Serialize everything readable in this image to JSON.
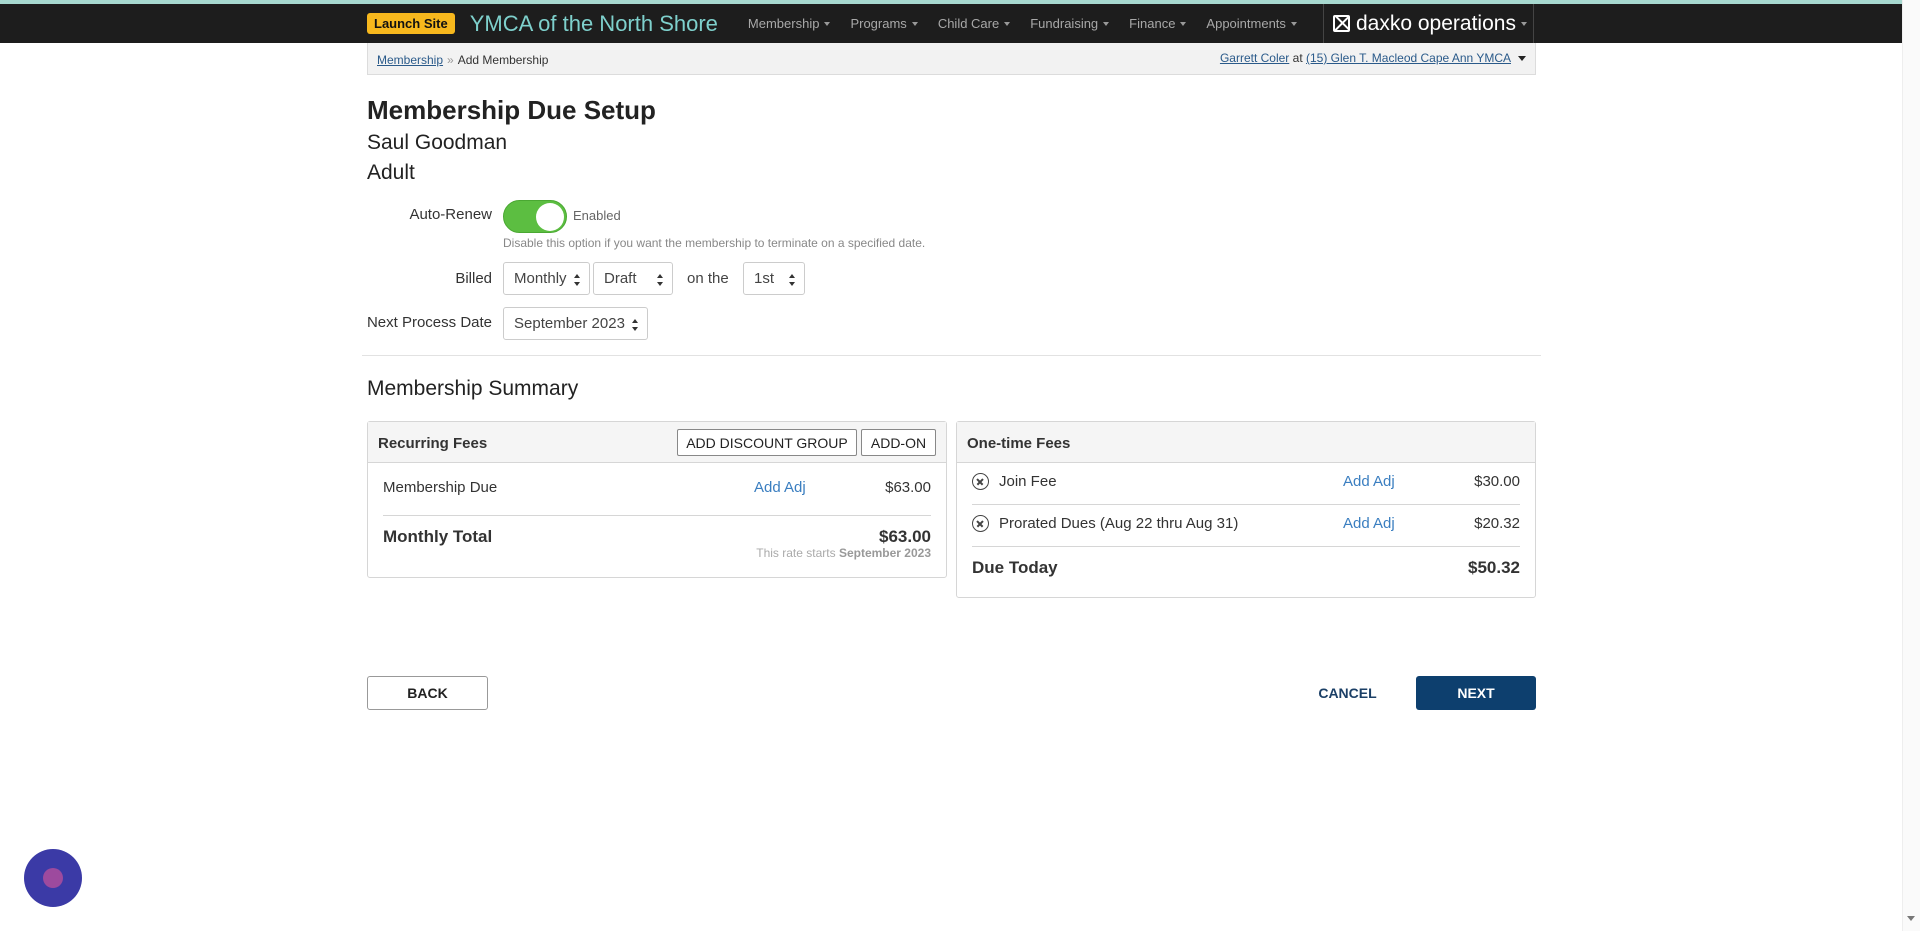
{
  "header": {
    "launch_label": "Launch Site",
    "brand_title": "YMCA of the North Shore",
    "nav_items": [
      {
        "label": "Membership"
      },
      {
        "label": "Programs"
      },
      {
        "label": "Child Care"
      },
      {
        "label": "Fundraising"
      },
      {
        "label": "Finance"
      },
      {
        "label": "Appointments"
      }
    ],
    "product_name": "daxko operations",
    "product_icon": "daxko-logo-icon"
  },
  "breadcrumb": {
    "parent": "Membership",
    "separator": "»",
    "current": "Add Membership"
  },
  "user": {
    "name": "Garrett Coler",
    "at": "at",
    "location": "(15) Glen T. Macleod Cape Ann YMCA"
  },
  "page": {
    "title": "Membership Due Setup",
    "member_name": "Saul Goodman",
    "member_type": "Adult"
  },
  "form": {
    "auto_renew_label": "Auto-Renew",
    "auto_renew_enabled": true,
    "auto_renew_state": "Enabled",
    "auto_renew_help": "Disable this option if you want the membership to terminate on a specified date.",
    "billed_label": "Billed",
    "billing_frequency": "Monthly",
    "billing_method": "Draft",
    "on_the_label": "on the",
    "billing_day": "1st",
    "next_process_label": "Next Process Date",
    "next_process_date": "September 2023"
  },
  "summary": {
    "title": "Membership Summary",
    "recurring": {
      "title": "Recurring Fees",
      "add_discount_label": "ADD DISCOUNT GROUP",
      "add_on_label": "ADD-ON",
      "items": [
        {
          "name": "Membership Due",
          "adj_label": "Add Adj",
          "amount": "$63.00"
        }
      ],
      "total_label": "Monthly Total",
      "total_amount": "$63.00",
      "rate_note_prefix": "This rate starts",
      "rate_note_date": "September 2023"
    },
    "one_time": {
      "title": "One-time Fees",
      "items": [
        {
          "name": "Join Fee",
          "adj_label": "Add Adj",
          "amount": "$30.00"
        },
        {
          "name": "Prorated Dues (Aug 22 thru Aug 31)",
          "adj_label": "Add Adj",
          "amount": "$20.32"
        }
      ],
      "total_label": "Due Today",
      "total_amount": "$50.32"
    }
  },
  "actions": {
    "back_label": "BACK",
    "cancel_label": "CANCEL",
    "next_label": "NEXT"
  },
  "colors": {
    "accent_strip": "#a7d8cf",
    "nav_background": "#1d1d1d",
    "brand_text": "#7ed0cc",
    "launch_button": "#f7b81d",
    "toggle_on": "#5cbe41",
    "link": "#3a7ec0",
    "primary_button": "#0d3f6e",
    "chat_widget": "#3b3aa6"
  }
}
